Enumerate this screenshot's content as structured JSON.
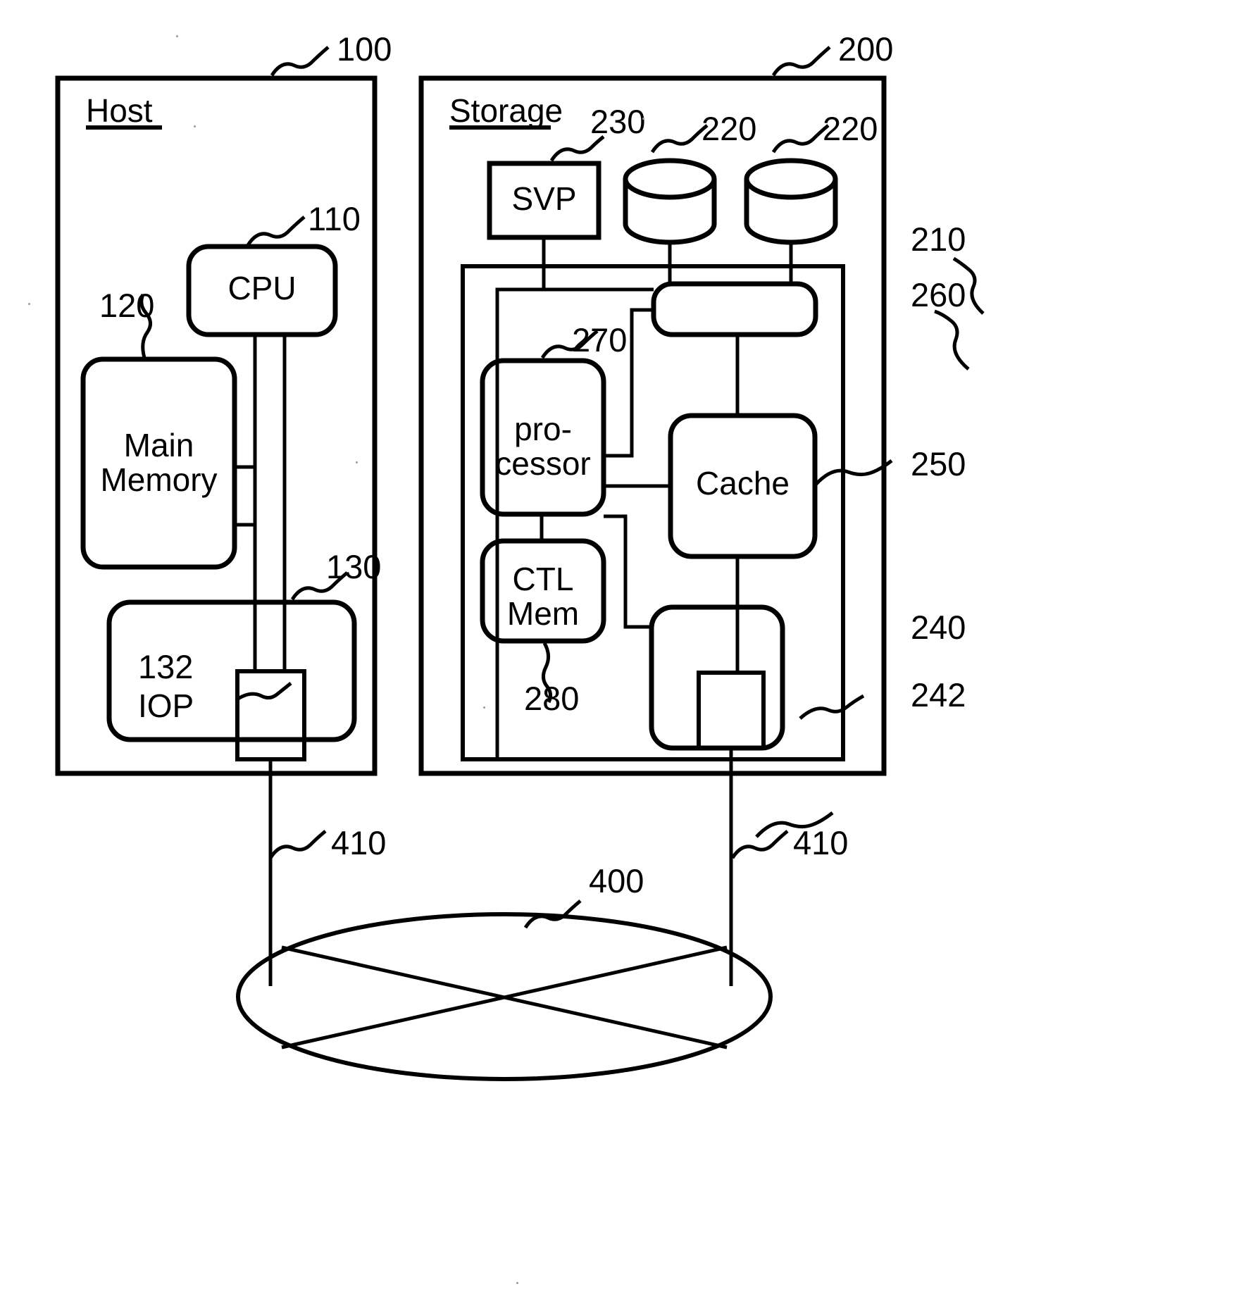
{
  "figure": {
    "type": "patent-block-diagram",
    "description": "Host and Storage system block diagram connected via a network",
    "background_color": "#ffffff",
    "line_color": "#000000"
  },
  "host": {
    "section_title": "Host",
    "ref": "100",
    "blocks": {
      "cpu": {
        "label": "CPU",
        "ref": "110"
      },
      "main_memory": {
        "label_line1": "Main",
        "label_line2": "Memory",
        "ref": "120"
      },
      "iop": {
        "label": "IOP",
        "ref": "130"
      },
      "iop_port": {
        "label": "",
        "ref": "132"
      }
    }
  },
  "storage": {
    "section_title": "Storage",
    "ref": "200",
    "blocks": {
      "svp": {
        "label": "SVP",
        "ref": "230"
      },
      "disk_left": {
        "label": "",
        "ref": "220"
      },
      "disk_right": {
        "label": "",
        "ref": "220"
      },
      "controller": {
        "label": "",
        "ref": "210"
      },
      "disk_adapter": {
        "label": "",
        "ref": "260"
      },
      "processor": {
        "label_line1": "pro-",
        "label_line2": "cessor",
        "ref": "270"
      },
      "ctl_mem": {
        "label_line1": "CTL",
        "label_line2": "Mem",
        "ref": "280"
      },
      "cache": {
        "label": "Cache",
        "ref": "250"
      },
      "channel_adapter": {
        "label": "",
        "ref": "240"
      },
      "channel_port": {
        "label": "",
        "ref": "242"
      }
    }
  },
  "network": {
    "label": "",
    "ref": "400",
    "links": [
      {
        "label": "",
        "ref": "410",
        "side": "left"
      },
      {
        "label": "",
        "ref": "410",
        "side": "right"
      }
    ]
  },
  "reference_numerals": [
    "100",
    "110",
    "120",
    "130",
    "132",
    "200",
    "210",
    "220",
    "220",
    "230",
    "240",
    "242",
    "250",
    "260",
    "270",
    "280",
    "400",
    "410",
    "410"
  ]
}
